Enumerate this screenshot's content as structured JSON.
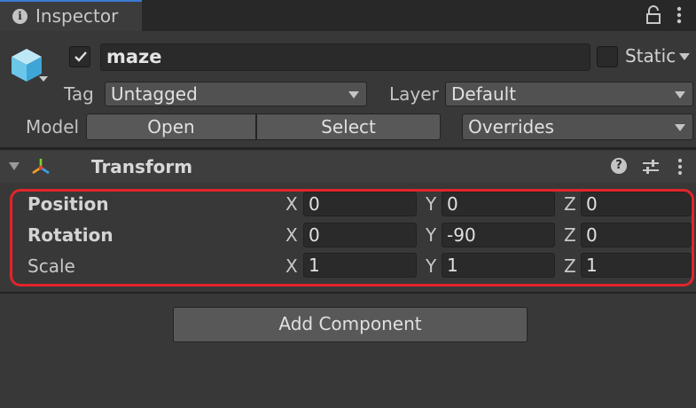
{
  "window": {
    "tab_label": "Inspector",
    "tab_icon": "info-icon"
  },
  "object": {
    "active": true,
    "name": "maze",
    "static_label": "Static",
    "static": false,
    "icon": "prefab-cube-icon"
  },
  "tag": {
    "label": "Tag",
    "value": "Untagged"
  },
  "layer": {
    "label": "Layer",
    "value": "Default"
  },
  "model": {
    "label": "Model",
    "open_label": "Open",
    "select_label": "Select",
    "overrides_label": "Overrides"
  },
  "transform": {
    "title": "Transform",
    "position": {
      "label": "Position",
      "x": "0",
      "y": "0",
      "z": "0"
    },
    "rotation": {
      "label": "Rotation",
      "x": "0",
      "y": "-90",
      "z": "0"
    },
    "scale": {
      "label": "Scale",
      "x": "1",
      "y": "1",
      "z": "1"
    },
    "axes": {
      "x": "X",
      "y": "Y",
      "z": "Z"
    }
  },
  "add_component_label": "Add Component",
  "colors": {
    "background": "#383838",
    "highlight": "#e3242b"
  }
}
